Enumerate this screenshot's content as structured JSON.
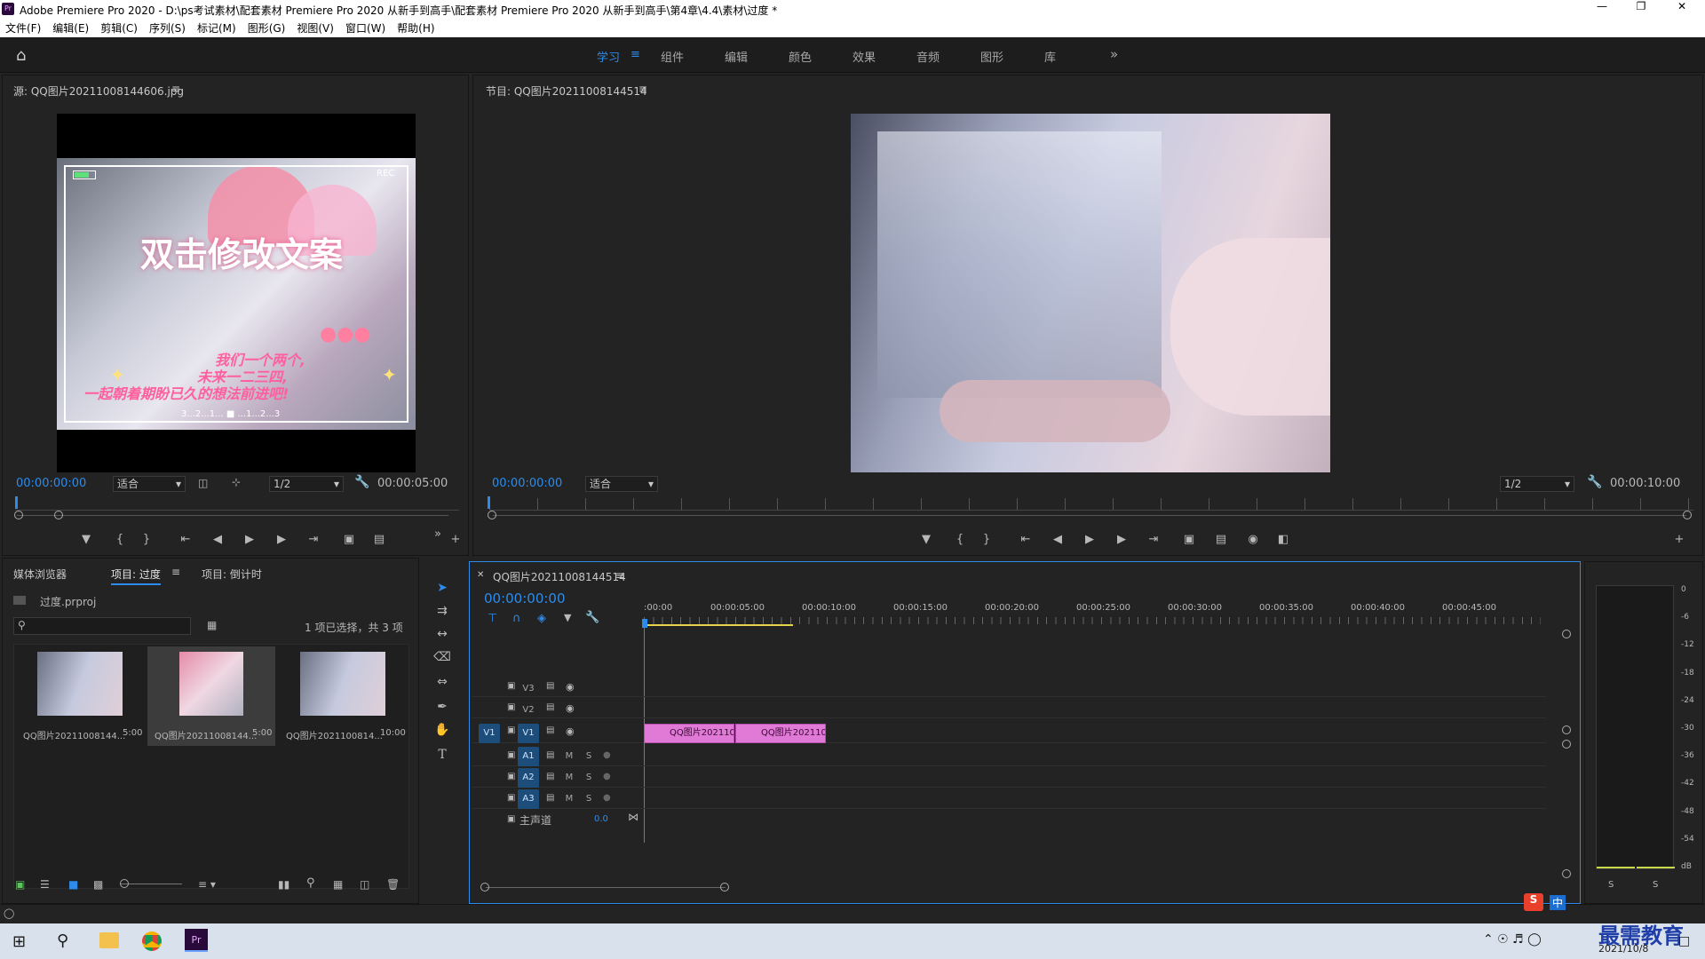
{
  "window": {
    "title": "Adobe Premiere Pro 2020 - D:\\ps考试素材\\配套素材 Premiere Pro 2020 从新手到高手\\配套素材 Premiere Pro 2020 从新手到高手\\第4章\\4.4\\素材\\过度 *",
    "app_icon": "Pr"
  },
  "menu": [
    "文件(F)",
    "编辑(E)",
    "剪辑(C)",
    "序列(S)",
    "标记(M)",
    "图形(G)",
    "视图(V)",
    "窗口(W)",
    "帮助(H)"
  ],
  "workspaces": [
    "学习",
    "组件",
    "编辑",
    "颜色",
    "效果",
    "音频",
    "图形",
    "库"
  ],
  "workspace_active": "学习",
  "source": {
    "title": "源: QQ图片20211008144606.jpg",
    "timecode": "00:00:00:00",
    "fit": "适合",
    "resolution": "1/2",
    "duration": "00:00:05:00",
    "overlay_text": "双击修改文案",
    "overlay_sub1": "我们一个两个,",
    "overlay_sub2": "未来一二三四,",
    "overlay_sub3": "一起朝着期盼已久的想法前进吧!",
    "overlay_count": "3...2...1...  ■ ...1...2...3",
    "rec_label": "REC"
  },
  "program": {
    "title": "节目: QQ图片20211008144514",
    "timecode": "00:00:00:00",
    "fit": "适合",
    "resolution": "1/2",
    "duration": "00:00:10:00"
  },
  "project": {
    "tabs": [
      "媒体浏览器",
      "项目: 过度",
      "项目: 倒计时"
    ],
    "active_tab": "项目: 过度",
    "file": "过度.prproj",
    "selection_info": "1 项已选择，共 3 项",
    "items": [
      {
        "name": "QQ图片20211008144...",
        "duration": "5:00"
      },
      {
        "name": "QQ图片20211008144...",
        "duration": "5:00"
      },
      {
        "name": "QQ图片2021100814...",
        "duration": "10:00"
      }
    ]
  },
  "timeline": {
    "tab": "QQ图片20211008144514",
    "timecode": "00:00:00:00",
    "ruler": [
      ":00:00",
      "00:00:05:00",
      "00:00:10:00",
      "00:00:15:00",
      "00:00:20:00",
      "00:00:25:00",
      "00:00:30:00",
      "00:00:35:00",
      "00:00:40:00",
      "00:00:45:00"
    ],
    "video_tracks": [
      "V3",
      "V2",
      "V1"
    ],
    "source_target": "V1",
    "audio_tracks": [
      "A1",
      "A2",
      "A3"
    ],
    "mute": "M",
    "solo": "S",
    "master_label": "主声道",
    "master_value": "0.0",
    "clips": [
      {
        "name": "QQ图片2021100"
      },
      {
        "name": "QQ图片2021100"
      }
    ]
  },
  "meter": {
    "scale": [
      "0",
      "-6",
      "-12",
      "-18",
      "-24",
      "-30",
      "-36",
      "-42",
      "-48",
      "-54",
      "dB"
    ],
    "solo_buttons": [
      "S",
      "S"
    ]
  },
  "taskbar": {
    "date": "2021/10/8",
    "watermark": "最需教育",
    "ime": "中"
  },
  "colors": {
    "accent": "#2d8ceb",
    "clip": "#e07ad6",
    "panel": "#232323"
  }
}
